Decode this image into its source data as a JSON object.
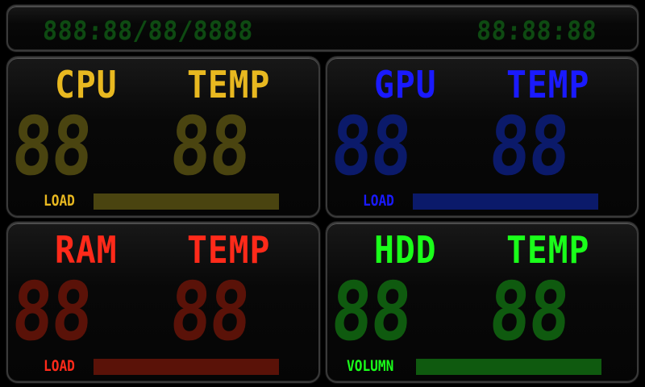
{
  "header": {
    "date_display": "888:88/88/8888",
    "time_display": "88:88:88"
  },
  "colors": {
    "cpu_label": "#e8b820",
    "cpu_dim": "#4a4410",
    "gpu_label": "#1a1aff",
    "gpu_dim": "#0b1a6a",
    "ram_label": "#ff2a1a",
    "ram_dim": "#5a1208",
    "hdd_label": "#1aff1a",
    "hdd_dim": "#0f5a0f"
  },
  "cards": {
    "cpu": {
      "name": "CPU",
      "temp_label": "TEMP",
      "load_value": "88",
      "temp_value": "88",
      "bar_label": "LOAD",
      "bar_fraction": 1.0
    },
    "gpu": {
      "name": "GPU",
      "temp_label": "TEMP",
      "load_value": "88",
      "temp_value": "88",
      "bar_label": "LOAD",
      "bar_fraction": 1.0
    },
    "ram": {
      "name": "RAM",
      "temp_label": "TEMP",
      "load_value": "88",
      "temp_value": "88",
      "bar_label": "LOAD",
      "bar_fraction": 1.0
    },
    "hdd": {
      "name": "HDD",
      "temp_label": "TEMP",
      "load_value": "88",
      "temp_value": "88",
      "bar_label": "VOLUMN",
      "bar_fraction": 1.0
    }
  }
}
